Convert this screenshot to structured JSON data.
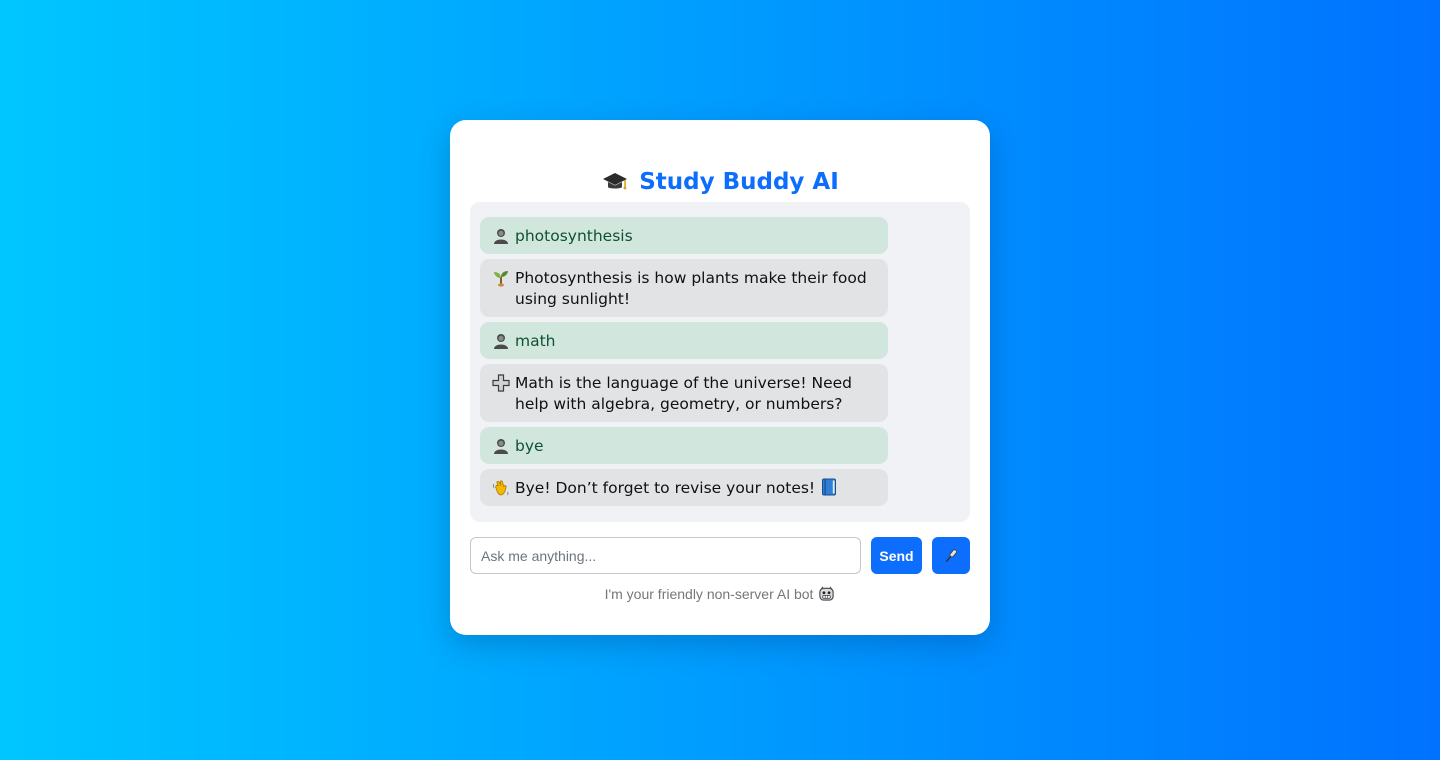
{
  "app": {
    "title": "Study Buddy AI",
    "title_icon": "graduation-cap-icon",
    "accent_color": "#0d6efd"
  },
  "messages": [
    {
      "role": "user",
      "icon": "user-icon",
      "text": "photosynthesis"
    },
    {
      "role": "bot",
      "icon": "seedling-icon",
      "text": "Photosynthesis is how plants make their food using sunlight!"
    },
    {
      "role": "user",
      "icon": "user-icon",
      "text": "math"
    },
    {
      "role": "bot",
      "icon": "plus-icon",
      "text": "Math is the language of the universe! Need help with algebra, geometry, or numbers?"
    },
    {
      "role": "user",
      "icon": "user-icon",
      "text": "bye"
    },
    {
      "role": "bot",
      "icon": "waving-hand-icon",
      "text": "Bye! Don’t forget to revise your notes!",
      "trailing_icon": "blue-book-icon"
    }
  ],
  "input": {
    "placeholder": "Ask me anything...",
    "value": ""
  },
  "buttons": {
    "send_label": "Send",
    "mic_icon": "microphone-icon"
  },
  "footer": {
    "text": "I'm your friendly non-server AI bot",
    "icon": "bot-face-icon"
  }
}
